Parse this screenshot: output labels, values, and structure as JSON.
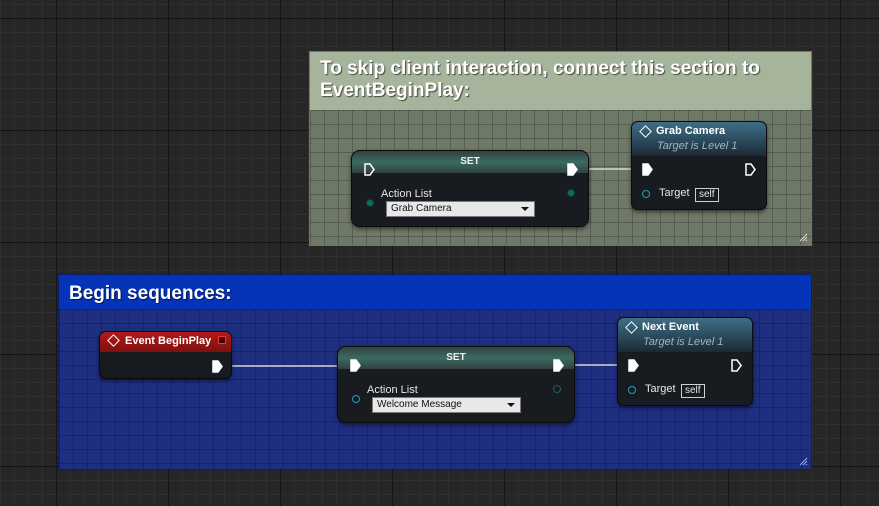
{
  "comments": {
    "skip": {
      "title": "To skip client interaction, connect this section to EventBeginPlay:",
      "color": "#a7b49c"
    },
    "begin": {
      "title": "Begin sequences:",
      "color": "#0634b8"
    }
  },
  "nodes": {
    "set_top": {
      "title": "SET",
      "pin_label": "Action List",
      "selected_value": "Grab Camera"
    },
    "grab_camera": {
      "title": "Grab Camera",
      "subtitle": "Target is Level 1",
      "target_label": "Target",
      "target_value": "self"
    },
    "event_begin_play": {
      "title": "Event BeginPlay"
    },
    "set_bottom": {
      "title": "SET",
      "pin_label": "Action List",
      "selected_value": "Welcome Message"
    },
    "next_event": {
      "title": "Next Event",
      "subtitle": "Target is Level 1",
      "target_label": "Target",
      "target_value": "self"
    }
  },
  "icons": {
    "function": "diamond-outline-icon",
    "exec_pin": "exec-arrow-icon",
    "data_pin": "object-pin-circle-icon",
    "event_stop": "stop-square-icon",
    "dropdown": "chevron-down-icon",
    "resize": "resize-grip-icon"
  },
  "colors": {
    "event_header": "#b11a1a",
    "function_header": "#3f6e86",
    "object_pin": "#1aa3b8",
    "enum_pin": "#0f6b5e",
    "wire": "#d8d8d8"
  }
}
